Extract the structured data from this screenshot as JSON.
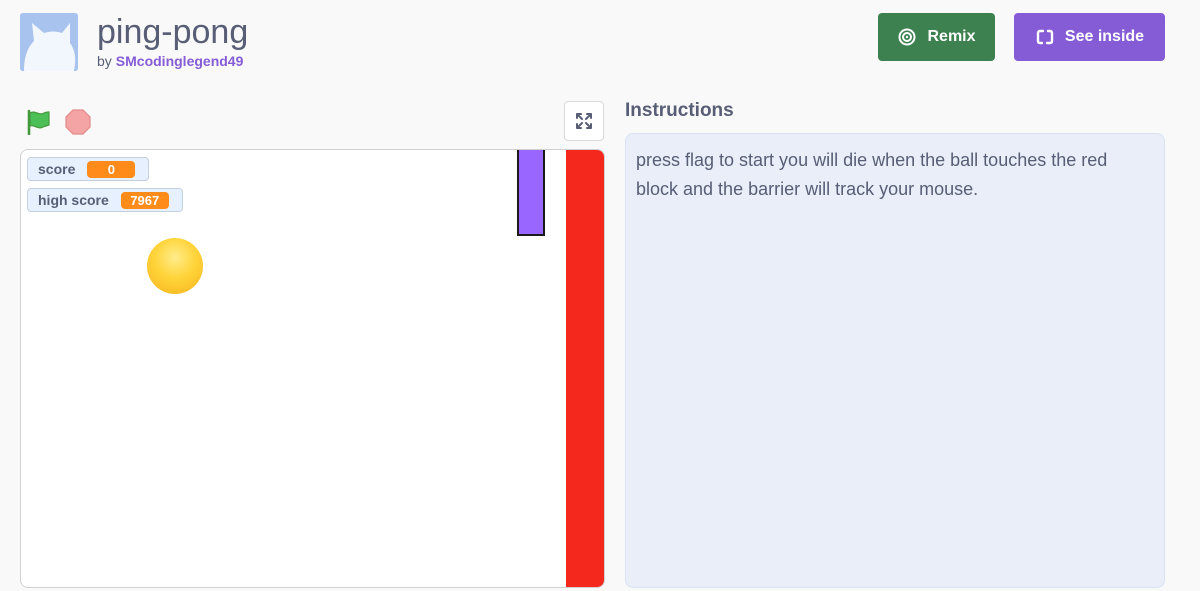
{
  "project": {
    "title": "ping-pong",
    "by_label": "by",
    "author": "SMcodinglegend49"
  },
  "actions": {
    "remix_label": "Remix",
    "see_inside_label": "See inside"
  },
  "controls": {
    "green_flag_icon": "green-flag-icon",
    "stop_icon": "stop-sign-icon",
    "fullscreen_icon": "fullscreen-icon"
  },
  "stage": {
    "monitors": [
      {
        "label": "score",
        "value": "0"
      },
      {
        "label": "high score",
        "value": "7967"
      }
    ],
    "colors": {
      "wall": "#f5281e",
      "paddle": "#9966ff",
      "ball": "#ffd43a",
      "monitor_value": "#ff8c1a"
    }
  },
  "instructions": {
    "heading": "Instructions",
    "text": "press flag to start you will die when the ball touches the red block and the barrier will track your mouse."
  },
  "theme": {
    "remix_color": "#3d8150",
    "see_inside_color": "#855cd6",
    "author_color": "#855cd6"
  }
}
